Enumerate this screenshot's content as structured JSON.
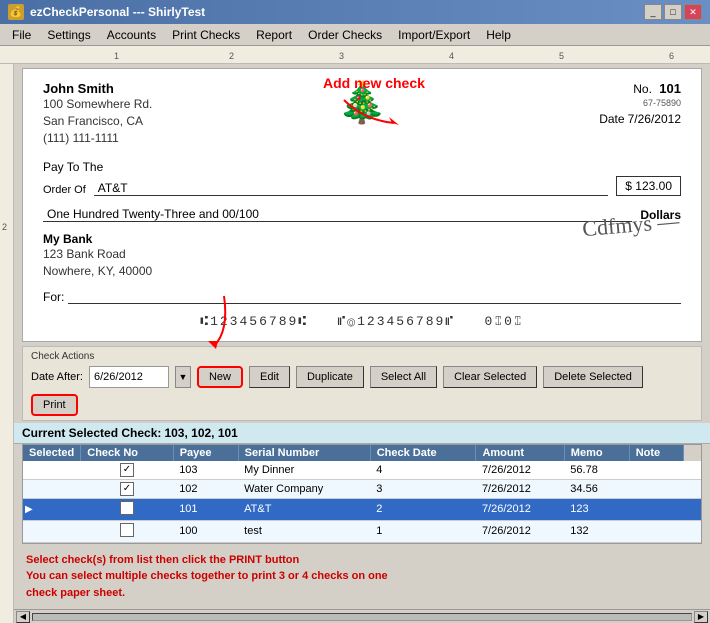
{
  "window": {
    "title": "ezCheckPersonal --- ShirlyTest",
    "icon": "💰"
  },
  "menu": {
    "items": [
      "File",
      "Settings",
      "Accounts",
      "Print Checks",
      "Report",
      "Order Checks",
      "Import/Export",
      "Help"
    ]
  },
  "check": {
    "name": "John Smith",
    "address_line1": "100 Somewhere Rd.",
    "address_line2": "San Francisco, CA",
    "address_line3": "(111) 111-1111",
    "no_label": "No.",
    "no_value": "101",
    "routing": "67-75890",
    "date_label": "Date",
    "date_value": "7/26/2012",
    "pay_to_label": "Pay To The",
    "order_of_label": "Order Of",
    "payee": "AT&T",
    "amount": "$ 123.00",
    "amount_words": "One Hundred Twenty-Three and 00/100",
    "dollars_label": "Dollars",
    "bank_name": "My Bank",
    "bank_address1": "123 Bank Road",
    "bank_address2": "Nowhere, KY, 40000",
    "for_label": "For:",
    "micr": "⑆123456789⑆  ⑈⓪123456789⑈  0⑄0⑄"
  },
  "annotation_add": "Add new check",
  "check_actions": {
    "title": "Check Actions",
    "date_after_label": "Date After:",
    "date_value": "6/26/2012",
    "buttons": [
      "New",
      "Edit",
      "Duplicate",
      "Select All",
      "Clear Selected",
      "Delete Selected",
      "Print"
    ]
  },
  "current_selected": {
    "label": "Current Selected Check:",
    "value": "103, 102, 101"
  },
  "table": {
    "headers": [
      "Selected",
      "Check No",
      "Payee",
      "Serial Number",
      "Check Date",
      "Amount",
      "Memo",
      "Note"
    ],
    "rows": [
      {
        "selected": true,
        "check_no": "103",
        "payee": "My Dinner",
        "serial": "4",
        "date": "7/26/2012",
        "amount": "56.78",
        "memo": "",
        "note": "",
        "active": false
      },
      {
        "selected": true,
        "check_no": "102",
        "payee": "Water Company",
        "serial": "3",
        "date": "7/26/2012",
        "amount": "34.56",
        "memo": "",
        "note": "",
        "active": false
      },
      {
        "selected": false,
        "check_no": "101",
        "payee": "AT&T",
        "serial": "2",
        "date": "7/26/2012",
        "amount": "123",
        "memo": "",
        "note": "",
        "active": true
      },
      {
        "selected": false,
        "check_no": "100",
        "payee": "test",
        "serial": "1",
        "date": "7/26/2012",
        "amount": "132",
        "memo": "",
        "note": "",
        "active": false
      }
    ]
  },
  "bottom_annotation": {
    "line1": "Select check(s) from list then click the PRINT button",
    "line2": "You can select multiple checks together to print 3 or 4 checks on one",
    "line3": "check paper sheet."
  }
}
